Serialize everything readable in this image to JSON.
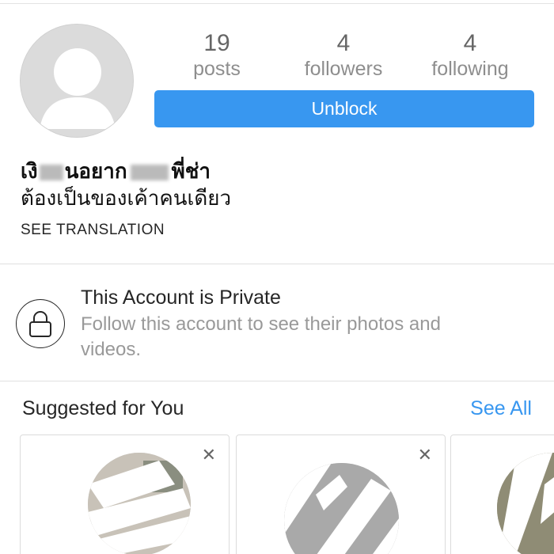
{
  "profile": {
    "stats": [
      {
        "value": "19",
        "label": "posts"
      },
      {
        "value": "4",
        "label": "followers"
      },
      {
        "value": "4",
        "label": "following"
      }
    ],
    "unblock_label": "Unblock",
    "bio_name_parts": [
      "เงิ",
      "นอยาก",
      "พี่ช่า"
    ],
    "bio_line": "ต้องเป็นของเค้าคนเดียว",
    "see_translation": "SEE TRANSLATION"
  },
  "private_notice": {
    "title": "This Account is Private",
    "subtitle": "Follow this account to see their photos and videos."
  },
  "suggested": {
    "title": "Suggested for You",
    "see_all": "See All",
    "close_glyph": "✕"
  },
  "colors": {
    "accent": "#3897f0",
    "text_primary": "#262626",
    "text_secondary": "#999999",
    "avatar_bg": "#dbdbdb"
  },
  "icons": {
    "avatar": "default-avatar-icon",
    "lock": "lock-icon",
    "close": "close-icon"
  }
}
